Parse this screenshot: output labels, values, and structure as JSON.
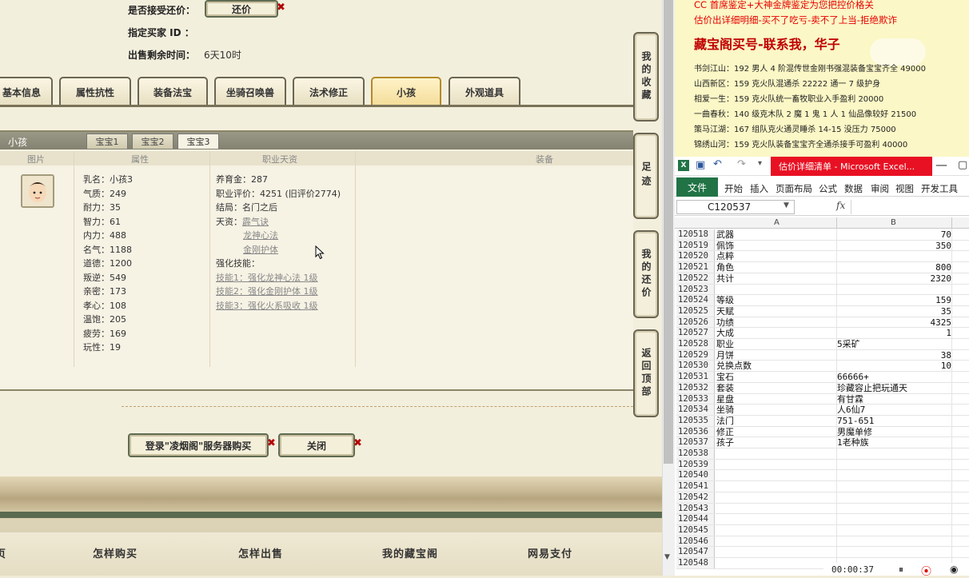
{
  "game": {
    "accept_counter_label": "是否接受还价：",
    "counter_button": "还价",
    "buyer_id_label": "指定买家 ID ：",
    "remaining_label": "出售剩余时间：",
    "remaining_value": "6天10时",
    "tabs": [
      "基本信息",
      "属性抗性",
      "装备法宝",
      "坐骑召唤兽",
      "法术修正",
      "小孩",
      "外观道具"
    ],
    "active_tab": "小孩",
    "pane_title": "小孩",
    "subtabs": [
      "宝宝1",
      "宝宝2",
      "宝宝3"
    ],
    "active_subtab": "宝宝3",
    "columns": [
      "图片",
      "属性",
      "职业天资",
      "装备"
    ],
    "attrs": [
      "乳名：小孩3",
      "气质：249",
      "耐力：35",
      "智力：61",
      "内力：488",
      "名气：1188",
      "道德：1200",
      "叛逆：549",
      "亲密：173",
      "孝心：108",
      "温饱：205",
      "疲劳：169",
      "玩性：19"
    ],
    "talent": {
      "raise_gold": "养育金：287",
      "career_score": "职业评价：4251 (旧评价2774)",
      "ending": "结局：名门之后",
      "gift_label": "天资：",
      "gifts": [
        "霹气诀",
        "龙神心法",
        "金刚护体"
      ],
      "skill_label": "强化技能：",
      "skills": [
        "技能1：强化龙神心法 1级",
        "技能2：强化金刚护体 1级",
        "技能3：强化火系吸收 1级"
      ]
    },
    "login_buy_button": "登录\"凌烟阁\"服务器购买",
    "close_button": "关闭",
    "footer_links": [
      "首页",
      "怎样购买",
      "怎样出售",
      "我的藏宝阁",
      "网易支付"
    ],
    "side_buttons": [
      "我的收藏",
      "足迹",
      "我的还价",
      "返回顶部"
    ]
  },
  "doc": {
    "red_lines": [
      "CC 首席鉴定+大神金牌鉴定为您把控价格关",
      "估价出详细明细-买不了吃亏-卖不了上当-拒绝欺诈"
    ],
    "heading": "藏宝阁买号-联系我，华子",
    "lines": [
      "书剑江山：192 男人 4 阶混传世金刚书强混装备宝宝齐全 49000",
      "山西新区：159 克火队混通杀 22222 通一 7 级护身",
      "相爱一生：159 克火队统一畜牧职业入手盈利 20000",
      "一曲春秋：140 级克木队 2 魔 1 鬼 1 人 1 仙品像较好 21500",
      "策马江湖：167 组队克火通灵睡杀 14-15 没压力 75000",
      "锦绣山河：159 克火队装备宝宝齐全通杀接手可盈利 40000"
    ]
  },
  "excel": {
    "window_title": "估价详细清单 - Microsoft Excel...",
    "file_tab": "文件",
    "ribbon_tabs": [
      "开始",
      "插入",
      "页面布局",
      "公式",
      "数据",
      "审阅",
      "视图",
      "开发工具"
    ],
    "name_box": "C120537",
    "fx": "fx",
    "col_headers": [
      "A",
      "B"
    ],
    "rows": [
      {
        "n": "120518",
        "a": "武器",
        "b": "70",
        "num": true
      },
      {
        "n": "120519",
        "a": "佩饰",
        "b": "350",
        "num": true
      },
      {
        "n": "120520",
        "a": "点粹",
        "b": "",
        "num": true
      },
      {
        "n": "120521",
        "a": "角色",
        "b": "800",
        "num": true
      },
      {
        "n": "120522",
        "a": "共计",
        "b": "2320",
        "num": true
      },
      {
        "n": "120523",
        "a": "",
        "b": "",
        "num": true
      },
      {
        "n": "120524",
        "a": "等级",
        "b": "159",
        "num": true
      },
      {
        "n": "120525",
        "a": "天赋",
        "b": "35",
        "num": true
      },
      {
        "n": "120526",
        "a": "功绩",
        "b": "4325",
        "num": true
      },
      {
        "n": "120527",
        "a": "大成",
        "b": "1",
        "num": true
      },
      {
        "n": "120528",
        "a": "职业",
        "b": "5采矿",
        "num": false
      },
      {
        "n": "120529",
        "a": "月饼",
        "b": "38",
        "num": true
      },
      {
        "n": "120530",
        "a": "兑换点数",
        "b": "10",
        "num": true
      },
      {
        "n": "120531",
        "a": "宝石",
        "b": "66666+",
        "num": false
      },
      {
        "n": "120532",
        "a": "套装",
        "b": "珍藏容止把玩通天",
        "num": false
      },
      {
        "n": "120533",
        "a": "星盘",
        "b": "有甘霖",
        "num": false
      },
      {
        "n": "120534",
        "a": "坐骑",
        "b": "人6仙7",
        "num": false
      },
      {
        "n": "120535",
        "a": "法门",
        "b": "751-651",
        "num": false
      },
      {
        "n": "120536",
        "a": "修正",
        "b": "男魔单修",
        "num": false
      },
      {
        "n": "120537",
        "a": "孩子",
        "b": "1老种族",
        "num": false
      },
      {
        "n": "120538",
        "a": "",
        "b": "",
        "num": false
      },
      {
        "n": "120539",
        "a": "",
        "b": "",
        "num": false
      },
      {
        "n": "120540",
        "a": "",
        "b": "",
        "num": false
      },
      {
        "n": "120541",
        "a": "",
        "b": "",
        "num": false
      },
      {
        "n": "120542",
        "a": "",
        "b": "",
        "num": false
      },
      {
        "n": "120543",
        "a": "",
        "b": "",
        "num": false
      },
      {
        "n": "120544",
        "a": "",
        "b": "",
        "num": false
      },
      {
        "n": "120545",
        "a": "",
        "b": "",
        "num": false
      },
      {
        "n": "120546",
        "a": "",
        "b": "",
        "num": false
      },
      {
        "n": "120547",
        "a": "",
        "b": "",
        "num": false
      },
      {
        "n": "120548",
        "a": "",
        "b": "",
        "num": false
      }
    ]
  },
  "recorder": {
    "time": "00:00:37"
  }
}
